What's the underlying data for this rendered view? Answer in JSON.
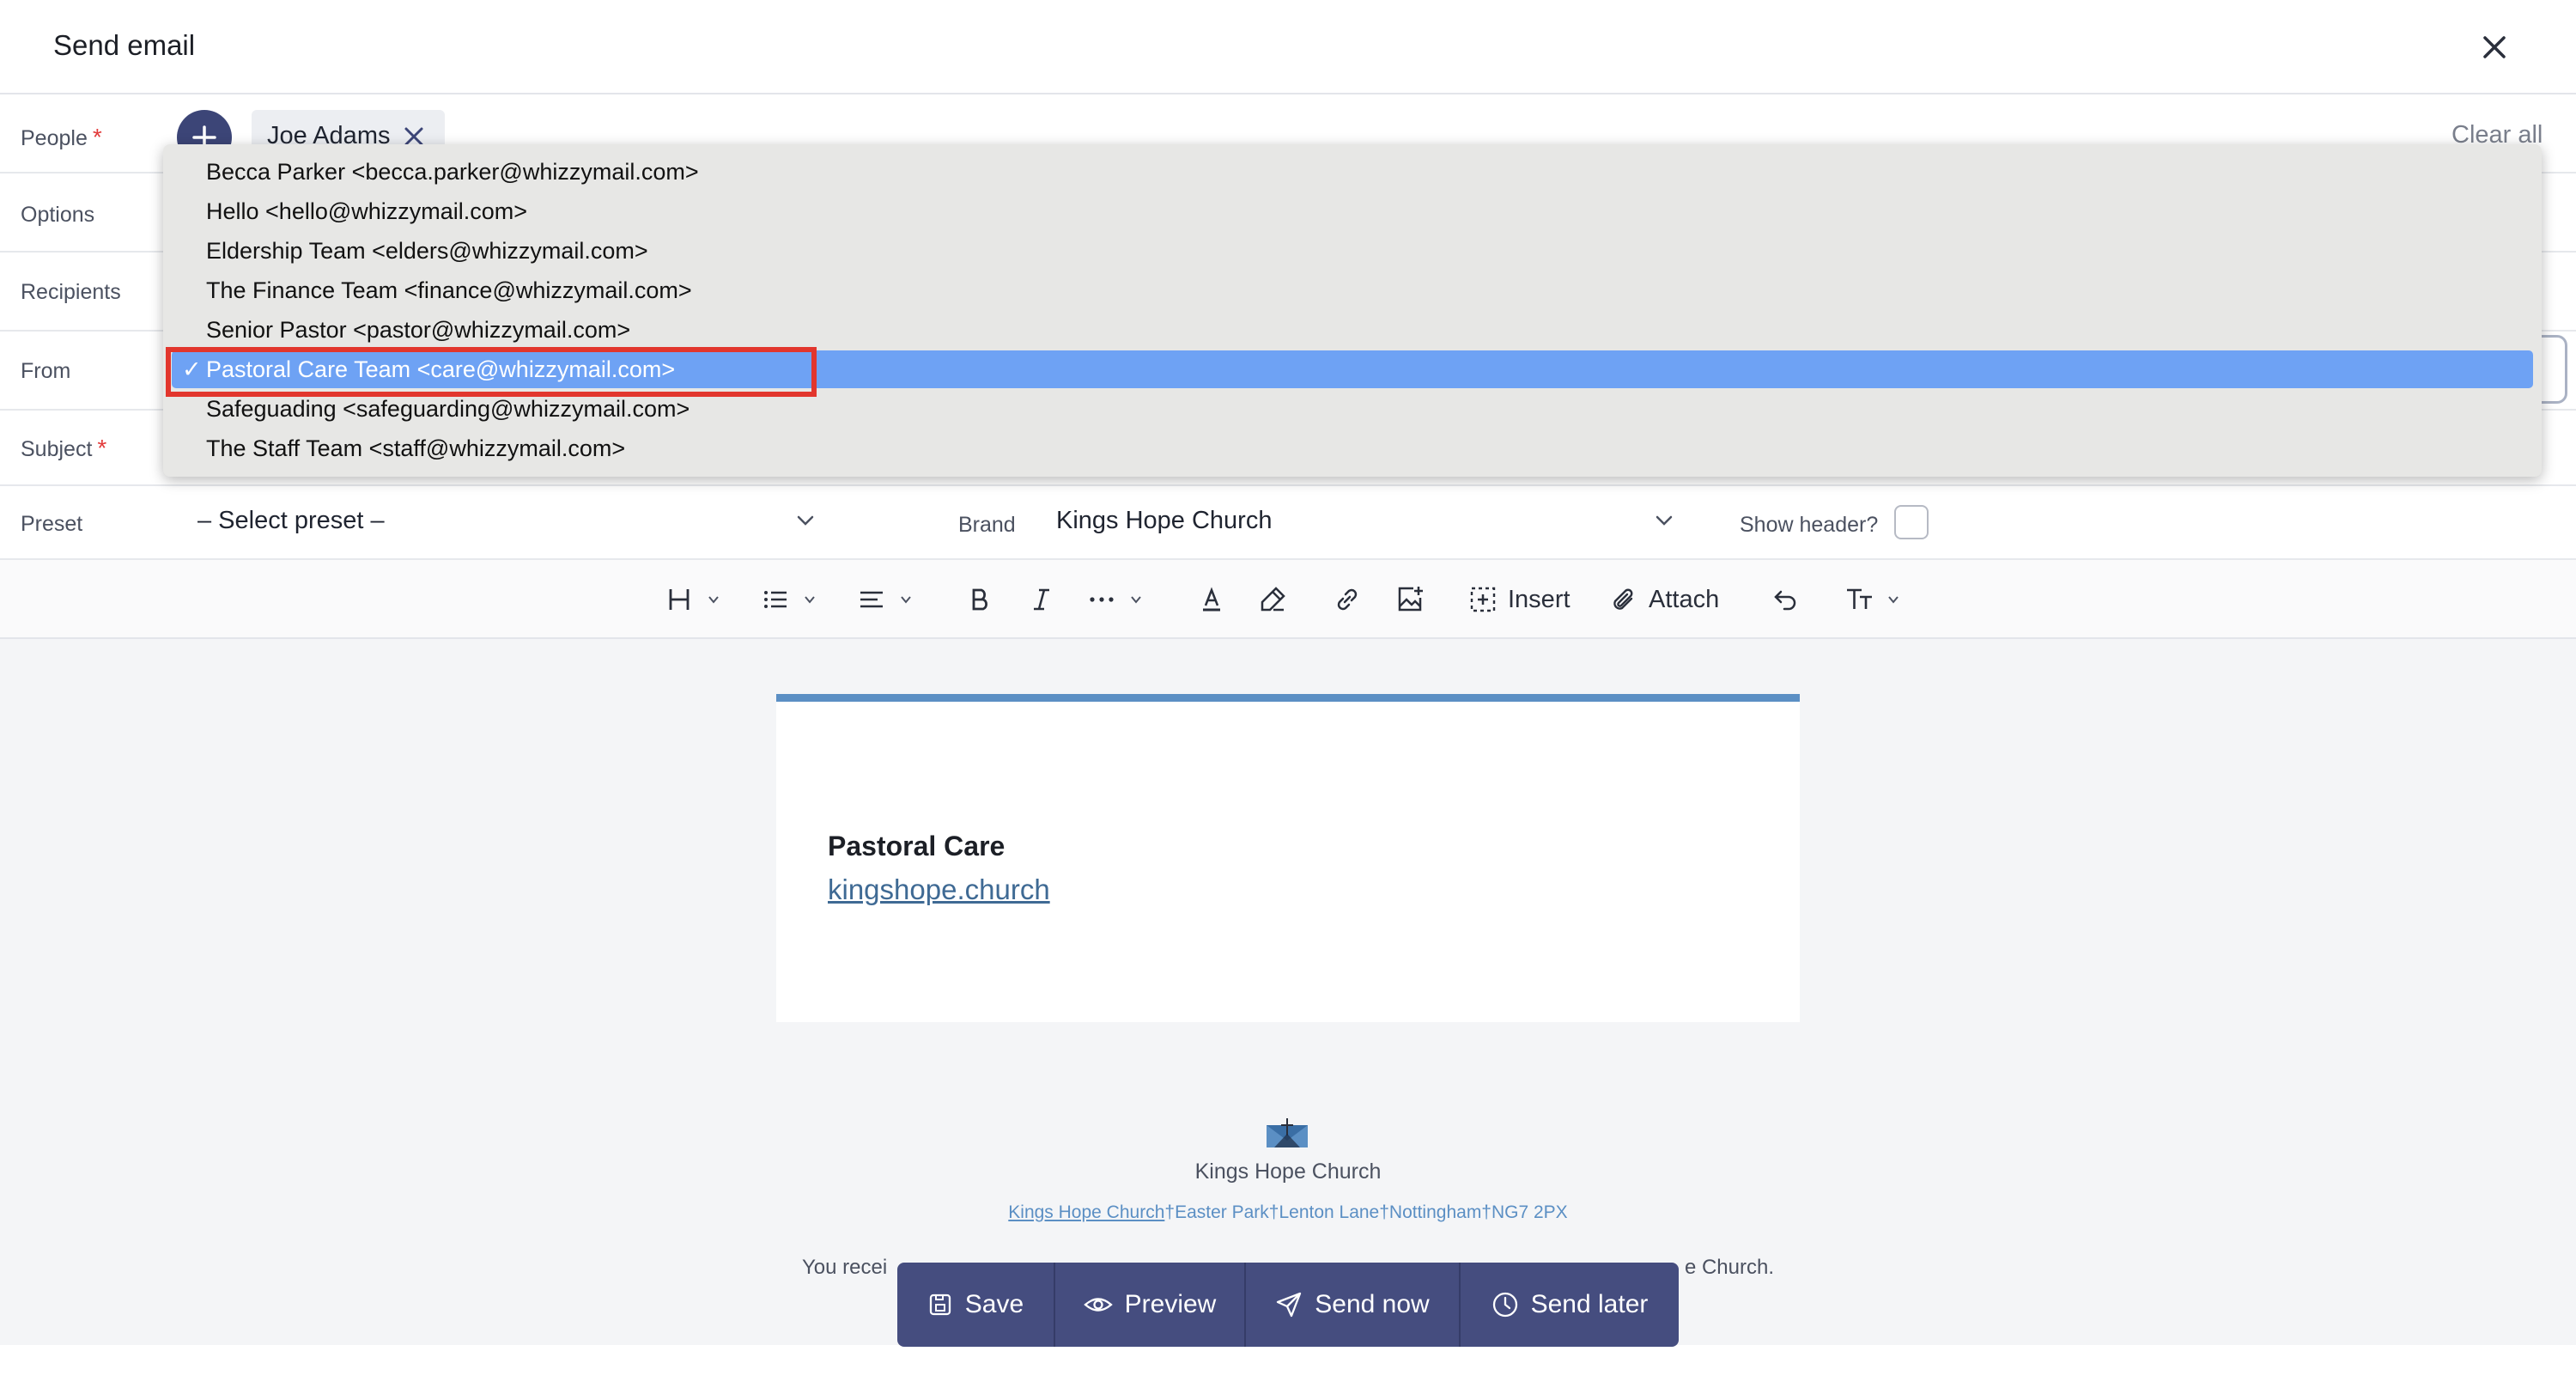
{
  "header": {
    "title": "Send email"
  },
  "form": {
    "people_label": "People",
    "required_mark": "*",
    "person_chip": "Joe Adams",
    "clear_all": "Clear all",
    "options_label": "Options",
    "recipients_label": "Recipients",
    "from_label": "From",
    "subject_label": "Subject",
    "preset_label": "Preset",
    "preset_value": "– Select preset –",
    "brand_label": "Brand",
    "brand_value": "Kings Hope Church",
    "show_header_label": "Show header?",
    "show_header_checked": false
  },
  "from_dropdown": {
    "options": [
      "Becca Parker <becca.parker@whizzymail.com>",
      "Hello <hello@whizzymail.com>",
      "Eldership Team <elders@whizzymail.com>",
      "The Finance Team <finance@whizzymail.com>",
      "Senior Pastor <pastor@whizzymail.com>",
      "Pastoral Care Team <care@whizzymail.com>",
      "Safeguading <safeguarding@whizzymail.com>",
      "The Staff Team <staff@whizzymail.com>"
    ],
    "selected_index": 5,
    "check_mark": "✓"
  },
  "toolbar": {
    "items": [
      "heading-icon",
      "list-icon",
      "align-icon",
      "bold-icon",
      "italic-icon",
      "more-icon",
      "text-color-icon",
      "highlight-icon",
      "link-icon",
      "image-icon"
    ],
    "insert_label": "Insert",
    "attach_label": "Attach"
  },
  "email_preview": {
    "signature_title": "Pastoral Care",
    "signature_link": "kingshope.church",
    "footer_org": "Kings Hope Church",
    "footer_address_link": "Kings Hope Church",
    "footer_address_rest": "†Easter Park†Lenton Lane†Nottingham†NG7 2PX",
    "footer_note_left": "You recei",
    "footer_note_right": "e Church."
  },
  "actions": {
    "save": "Save",
    "preview": "Preview",
    "send_now": "Send now",
    "send_later": "Send later"
  },
  "colors": {
    "accent": "#454d7f",
    "selected_option": "#6ea2f4",
    "highlight": "#e2362d",
    "card_top_border": "#5b8fc4"
  }
}
